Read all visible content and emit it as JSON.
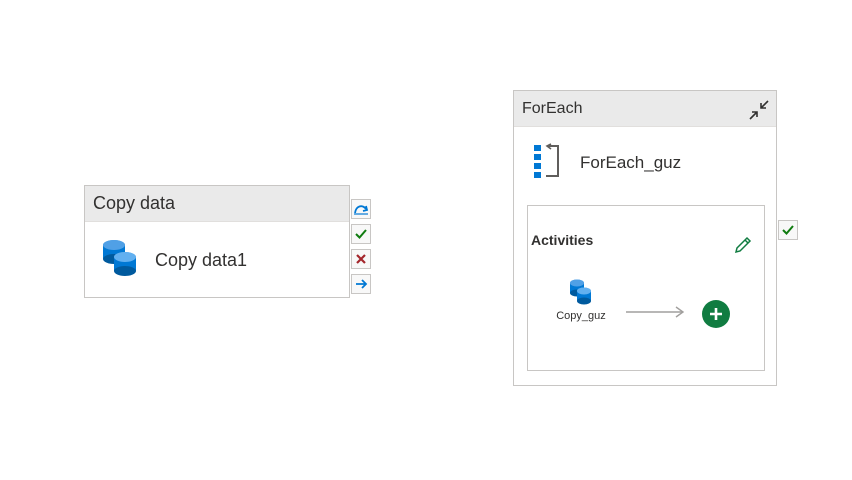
{
  "copy_activity": {
    "type_label": "Copy data",
    "name": "Copy data1",
    "icon": "database-icon"
  },
  "connectors": [
    {
      "name": "skip",
      "icon": "skip-arrow-icon"
    },
    {
      "name": "success",
      "icon": "check-icon"
    },
    {
      "name": "failure",
      "icon": "x-icon"
    },
    {
      "name": "completion",
      "icon": "arrow-right-icon"
    }
  ],
  "foreach_activity": {
    "type_label": "ForEach",
    "name": "ForEach_guz",
    "icon": "foreach-icon",
    "activities_title": "Activities",
    "inner_activity": {
      "name": "Copy_guz",
      "icon": "database-icon"
    }
  },
  "colors": {
    "header_bg": "#eaeaea",
    "border": "#c8c6c4",
    "accent_blue": "#0078d4",
    "success_green": "#107c10",
    "failure_red": "#a4262c",
    "add_green": "#107c41"
  }
}
